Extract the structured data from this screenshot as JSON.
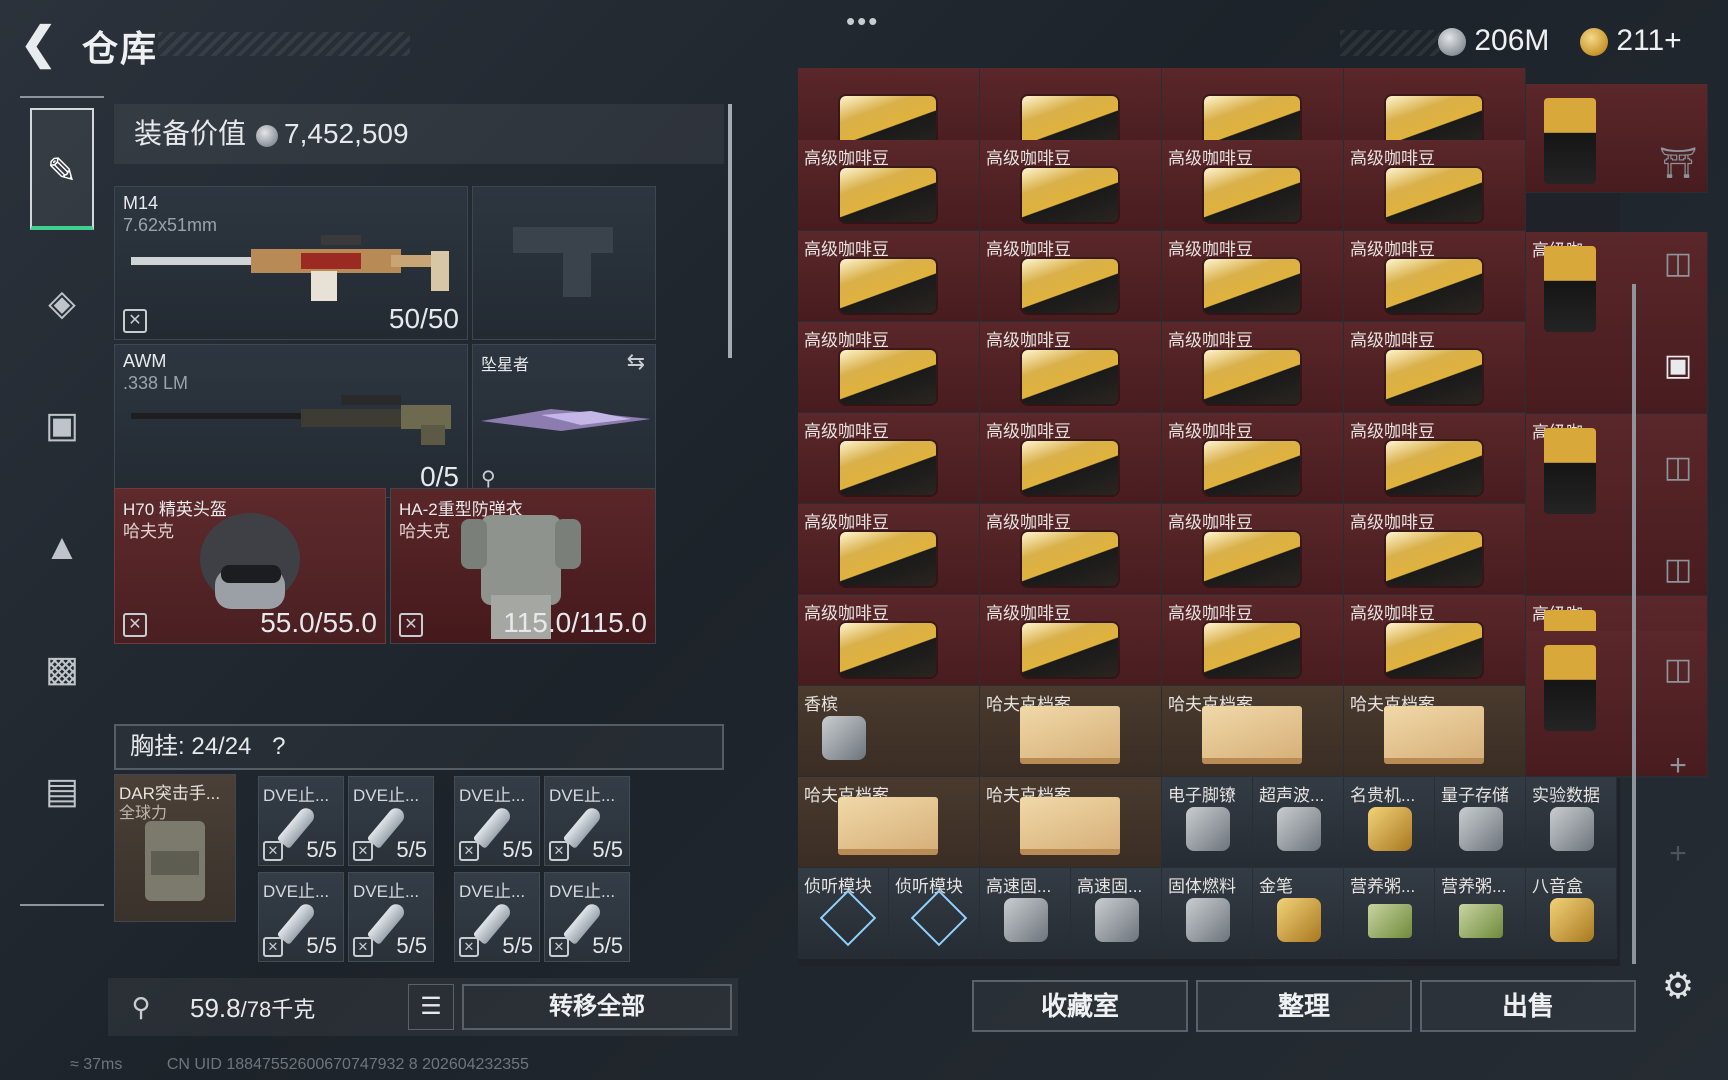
{
  "header": {
    "title": "仓库",
    "menu": "•••",
    "currency1": "206M",
    "currency2": "211+",
    "corner_tag": "ㅊㅊ/ㄴㅅ"
  },
  "equipment": {
    "value_label": "装备价值",
    "value": "7,452,509",
    "primary": {
      "name": "M14",
      "caliber": "7.62x51mm",
      "ammo": "50/50"
    },
    "secondary": {
      "name": "AWM",
      "caliber": ".338 LM",
      "ammo": "0/5"
    },
    "melee": {
      "name": "坠星者"
    },
    "helmet": {
      "name": "H70 精英头盔",
      "maker": "哈夫克",
      "durability": "55.0/55.0"
    },
    "armor": {
      "name": "HA-2重型防弹衣",
      "maker": "哈夫克",
      "durability": "115.0/115.0"
    },
    "rig_label": "胸挂",
    "rig_capacity": "24/24",
    "rig_help": "?",
    "rig_name": "DAR突击手...",
    "rig_sub": "全球力",
    "ammo_slots": [
      {
        "name": "DVE止...",
        "count": "5/5"
      },
      {
        "name": "DVE止...",
        "count": "5/5"
      },
      {
        "name": "DVE止...",
        "count": "5/5"
      },
      {
        "name": "DVE止...",
        "count": "5/5"
      },
      {
        "name": "DVE止...",
        "count": "5/5"
      },
      {
        "name": "DVE止...",
        "count": "5/5"
      },
      {
        "name": "DVE止...",
        "count": "5/5"
      },
      {
        "name": "DVE止...",
        "count": "5/5"
      }
    ],
    "weight": "59.8",
    "weight_max": "/78千克",
    "transfer_all": "转移全部"
  },
  "stash": {
    "items": {
      "coffee": "高级咖啡豆",
      "coffee_short": "高级咖...",
      "champagne": "香槟",
      "file": "哈夫克档案",
      "bracelet": "电子脚镣",
      "ultrasonic": "超声波...",
      "watch": "名贵机...",
      "quantum": "量子存储",
      "data": "实验数据",
      "listen": "侦听模块",
      "fuel1": "高速固...",
      "fuel2": "高速固...",
      "solid_fuel": "固体燃料",
      "gold_pen": "金笔",
      "porridge1": "营养粥...",
      "porridge2": "营养粥...",
      "octagon": "八音盒"
    },
    "buttons": {
      "collection": "收藏室",
      "organize": "整理",
      "sell": "出售"
    }
  },
  "status": {
    "ping": "37ms",
    "uid": "CN UID 18847552600670747932 8 202604232355"
  }
}
